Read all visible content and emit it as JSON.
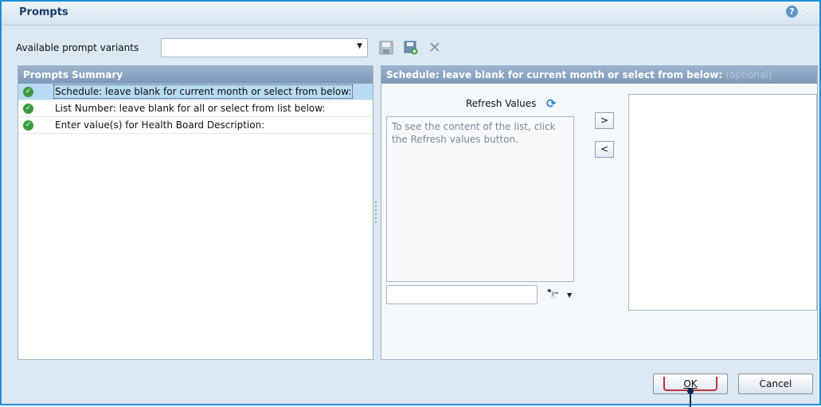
{
  "dialog": {
    "title": "Prompts"
  },
  "variants": {
    "label": "Available prompt variants",
    "selected_value": ""
  },
  "left_panel": {
    "header": "Prompts Summary",
    "prompts": [
      {
        "label": "Schedule: leave blank for current month or select from below:",
        "status": "complete",
        "selected": true
      },
      {
        "label": "List Number: leave blank for all or select from list below:",
        "status": "complete",
        "selected": false
      },
      {
        "label": "Enter value(s) for Health Board Description:",
        "status": "complete",
        "selected": false
      }
    ]
  },
  "right_panel": {
    "header": "Schedule: leave blank for current month or select from below:",
    "header_optional": "(optional)",
    "refresh_label": "Refresh Values",
    "values_hint": "To see the content of the list, click the Refresh values button.",
    "search_value": "",
    "move_right_label": ">",
    "move_left_label": "<"
  },
  "footer": {
    "ok_label": "OK",
    "cancel_label": "Cancel"
  },
  "colors": {
    "accent": "#1f8fd3",
    "header": "#8aa4c0",
    "selection": "#b8daf3",
    "success": "#3a9a3f"
  }
}
